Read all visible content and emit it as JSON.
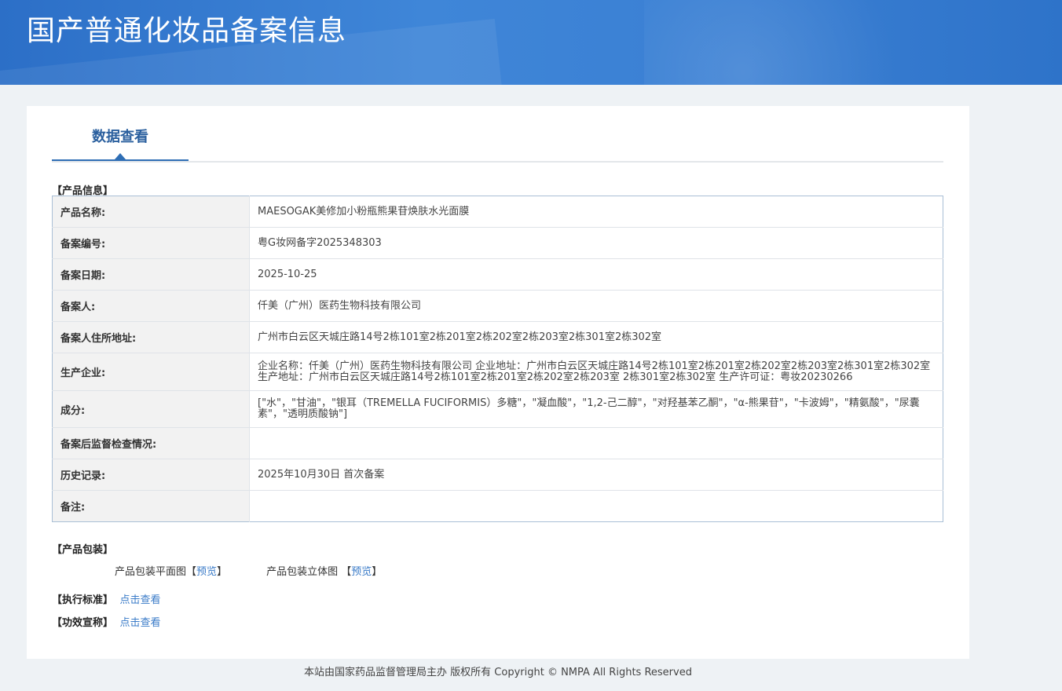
{
  "header": {
    "title": "国产普通化妆品备案信息"
  },
  "tab": {
    "label": "数据查看"
  },
  "sections": {
    "product_info": "【产品信息】",
    "packaging": "【产品包装】",
    "standard": "【执行标准】",
    "efficacy": "【功效宣称】"
  },
  "product_info": [
    {
      "key": "产品名称:",
      "value": "MAESOGAK美修加小粉瓶熊果苷焕肤水光面膜"
    },
    {
      "key": "备案编号:",
      "value": "粤G妆网备字2025348303"
    },
    {
      "key": "备案日期:",
      "value": "2025-10-25"
    },
    {
      "key": "备案人:",
      "value": "仟美（广州）医药生物科技有限公司"
    },
    {
      "key": "备案人住所地址:",
      "value": "广州市白云区天城庄路14号2栋101室2栋201室2栋202室2栋203室2栋301室2栋302室"
    },
    {
      "key": "生产企业:",
      "value": "企业名称：仟美（广州）医药生物科技有限公司 企业地址：广州市白云区天城庄路14号2栋101室2栋201室2栋202室2栋203室2栋301室2栋302室 生产地址：广州市白云区天城庄路14号2栋101室2栋201室2栋202室2栋203室 2栋301室2栋302室 生产许可证：粤妆20230266"
    },
    {
      "key": "成分:",
      "value": "[\"水\"，\"甘油\"，\"银耳（TREMELLA FUCIFORMIS）多糖\"，\"凝血酸\"，\"1,2-己二醇\"，\"对羟基苯乙酮\"，\"α-熊果苷\"，\"卡波姆\"，\"精氨酸\"，\"尿囊素\"，\"透明质酸钠\"]"
    },
    {
      "key": "备案后监督检查情况:",
      "value": ""
    },
    {
      "key": "历史记录:",
      "value": "2025年10月30日 首次备案"
    },
    {
      "key": "备注:",
      "value": ""
    }
  ],
  "packaging": {
    "flat_label": "产品包装平面图",
    "flat_link": "预览",
    "cube_label": "产品包装立体图",
    "cube_link": "预览"
  },
  "links": {
    "view": "点击查看"
  },
  "footer": {
    "text": "本站由国家药品监督管理局主办 版权所有 Copyright © NMPA All Rights Reserved"
  }
}
